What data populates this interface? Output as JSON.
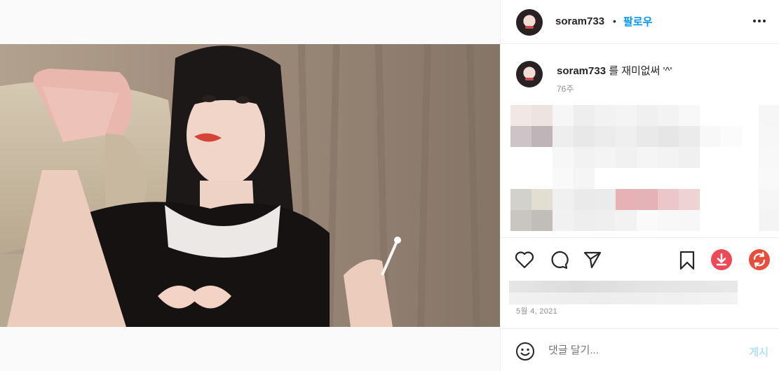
{
  "post": {
    "username": "soram733",
    "follow_label": "팔로우",
    "dot": "•",
    "caption_text": " 를 재미없써 '^'",
    "caption_age": "76주",
    "date": "5월 4, 2021"
  },
  "comment_box": {
    "placeholder": "댓글 달기...",
    "post_label": "게시"
  },
  "colors": {
    "follow_blue": "#0095f6",
    "download_red": "#ed4956",
    "share_red": "#e84e3a"
  },
  "icons": [
    "more-icon",
    "heart-icon",
    "comment-icon",
    "share-icon",
    "bookmark-icon",
    "download-icon",
    "repost-icon",
    "emoji-icon"
  ]
}
